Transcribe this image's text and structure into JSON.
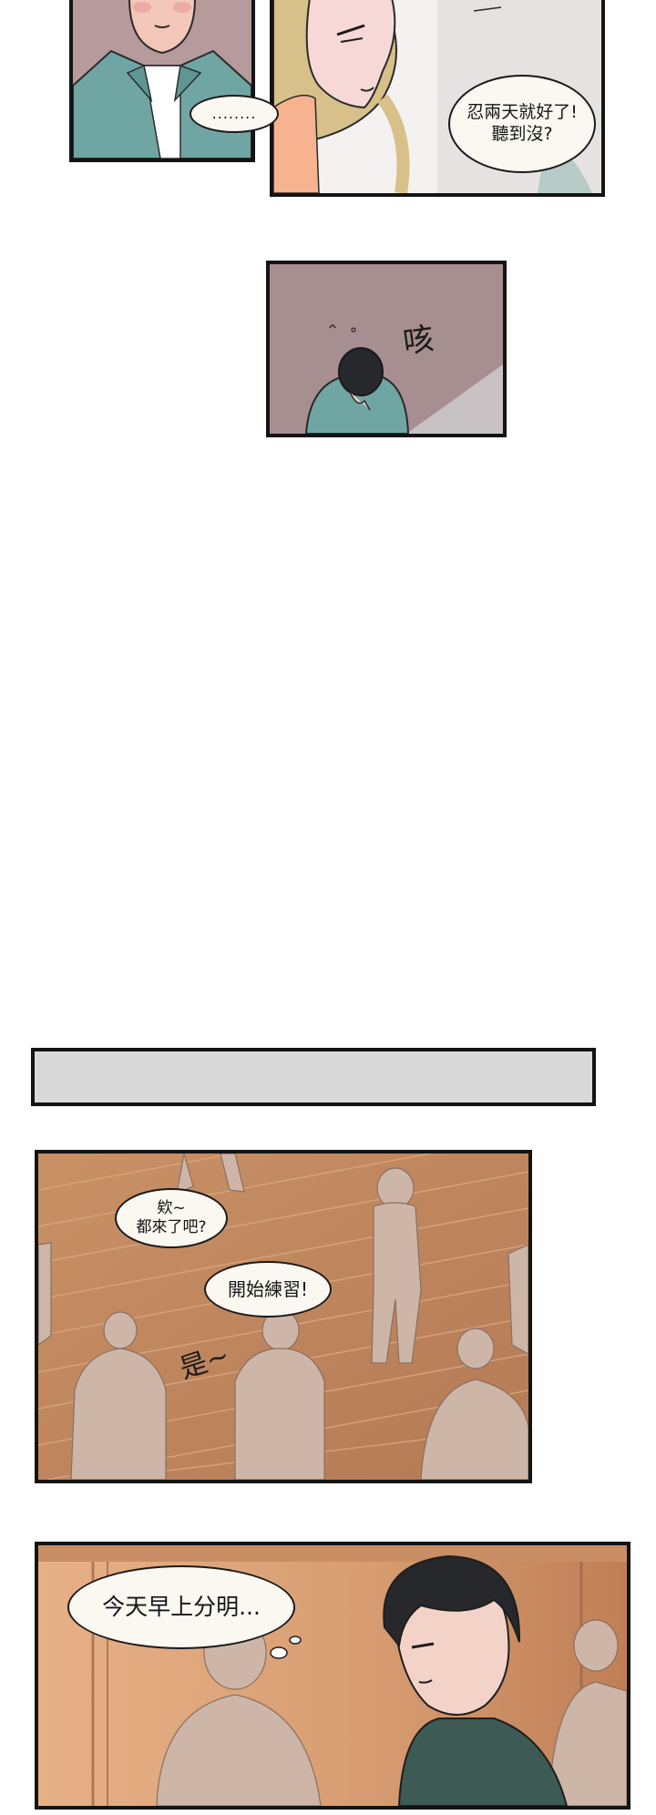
{
  "panels": {
    "p1": {
      "bubble_dots": "........"
    },
    "p2": {
      "bubble_text": "忍兩天就好了!\n聽到沒?"
    },
    "p3": {
      "sfx": "咳"
    },
    "p5": {
      "bubble_1": "欸~\n都來了吧?",
      "bubble_2": "開始練習!",
      "sfx": "是~"
    },
    "p6": {
      "bubble_text": "今天早上分明..."
    }
  },
  "colors": {
    "border": "#141414",
    "teal_shirt": "#6fa6a3",
    "mauve_bg": "#a78e90",
    "floor_wood": "#c99166",
    "gray_bar": "#d9d9d9",
    "hair_blonde": "#d7c089",
    "hair_dark": "#27282c",
    "dark_green": "#3d5a55"
  }
}
